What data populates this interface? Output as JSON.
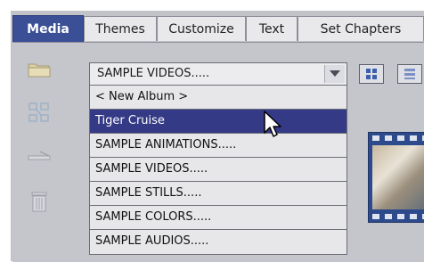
{
  "tabs": [
    {
      "label": "Media",
      "active": true
    },
    {
      "label": "Themes",
      "active": false
    },
    {
      "label": "Customize",
      "active": false
    },
    {
      "label": "Text",
      "active": false
    },
    {
      "label": "Set Chapters",
      "active": false
    }
  ],
  "album_dropdown": {
    "value": "SAMPLE VIDEOS.....",
    "options": [
      "< New Album >",
      "Tiger Cruise",
      "SAMPLE ANIMATIONS.....",
      "SAMPLE VIDEOS.....",
      "SAMPLE STILLS.....",
      "SAMPLE COLORS.....",
      "SAMPLE AUDIOS....."
    ],
    "highlighted_index": 1
  },
  "toolbar": {
    "icons": [
      "folder-icon",
      "organize-icon",
      "trim-icon",
      "trash-icon"
    ]
  },
  "view_buttons": [
    "thumbnail-view-icon",
    "list-view-icon"
  ],
  "colors": {
    "accent": "#3a4f96",
    "selection": "#343a86",
    "panel": "#c5c6cc"
  }
}
